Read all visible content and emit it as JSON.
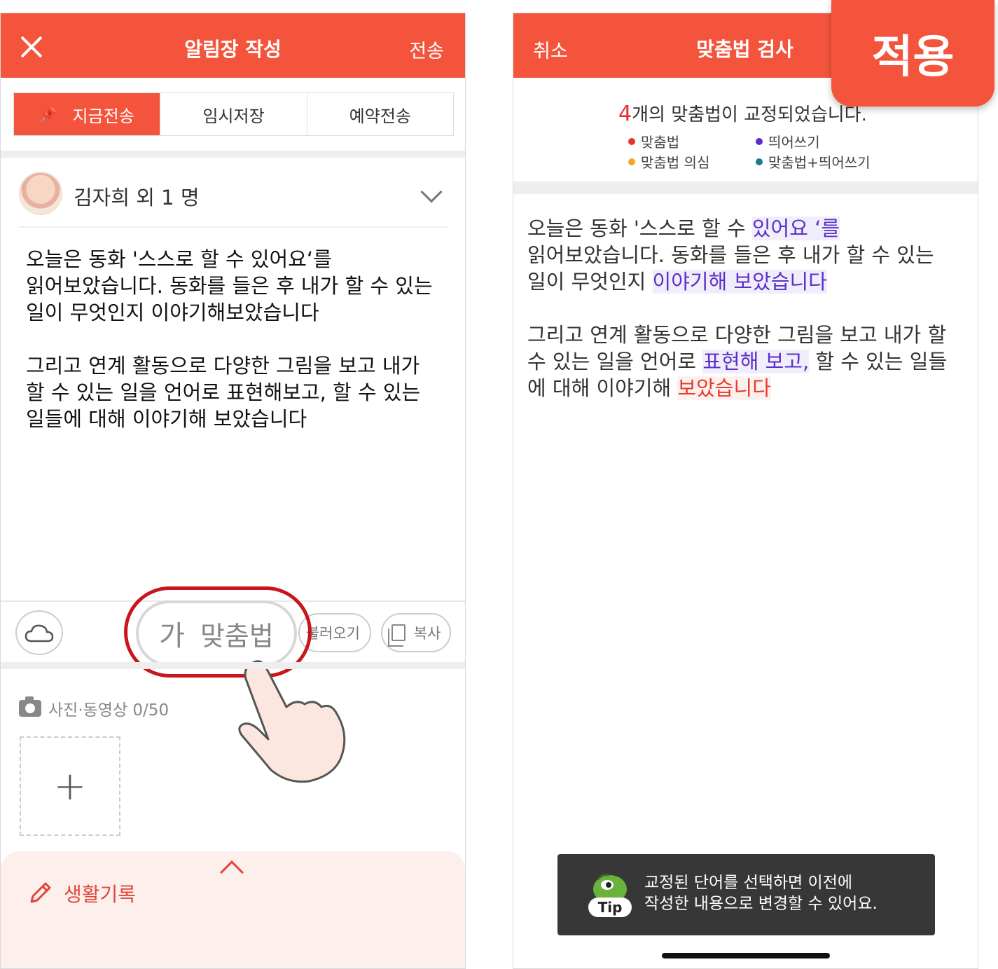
{
  "left_screen": {
    "header": {
      "title": "알림장 작성",
      "send": "전송"
    },
    "tabs": [
      {
        "label": "지금전송",
        "active": true
      },
      {
        "label": "임시저장",
        "active": false
      },
      {
        "label": "예약전송",
        "active": false
      }
    ],
    "recipient": "김자희 외 1 명",
    "body": {
      "p1": "오늘은 동화 '스스로 할 수 있어요‘를\n읽어보았습니다. 동화를 들은 후 내가 할 수 있는\n일이 무엇인지 이야기해보았습니다",
      "p2": "그리고 연계 활동으로 다양한 그림을 보고 내가\n할 수 있는 일을 언어로 표현해보고, 할 수 있는\n일들에 대해 이야기해 보았습니다"
    },
    "toolbar": {
      "spellcheck_icon": "가",
      "spellcheck_label": "맞춤법",
      "load": "불러오기",
      "copy": "복사"
    },
    "media": {
      "label": "사진·동영상 0/50",
      "add": "+"
    },
    "life_record": "생활기록"
  },
  "right_screen": {
    "header": {
      "cancel": "취소",
      "title": "맞춤법 검사",
      "apply": "적용"
    },
    "result": {
      "count": "4",
      "text": "개의 맞춤법이 교정되었습니다."
    },
    "legend": [
      {
        "label": "맞춤법",
        "color": "#e8342b"
      },
      {
        "label": "띄어쓰기",
        "color": "#5b30c9"
      },
      {
        "label": "맞춤법 의심",
        "color": "#f5a623"
      },
      {
        "label": "맞춤법+띄어쓰기",
        "color": "#1f7a8c"
      }
    ],
    "body": {
      "p1_line1_a": "오늘은 동화 '스스로 할 수 ",
      "p1_line1_mark": "있어요 ‘를",
      "p1_line2": "읽어보았습니다. 동화를 들은 후 내가 할 수 있는",
      "p1_line3_a": "일이 무엇인지 ",
      "p1_line3_mark": "이야기해 보았습니다",
      "p2_line1": "그리고 연계 활동으로 다양한 그림을 보고 내가 할",
      "p2_line2_a": "수 있는 일을 언어로 ",
      "p2_line2_mark": "표현해 보고,",
      "p2_line2_b": " 할 수 있는 일들",
      "p2_line3_a": "에 대해 이야기해 ",
      "p2_line3_mark": "보았습니다"
    },
    "tip": {
      "badge": "Tip",
      "line1": "교정된 단어를 선택하면 이전에",
      "line2": "작성한 내용으로 변경할 수 있어요."
    }
  },
  "colors": {
    "brand": "#f4543c",
    "highlight_ring": "#c9151c",
    "spacing_mark": "#5b30c9",
    "spelling_mark": "#e83a2e"
  }
}
